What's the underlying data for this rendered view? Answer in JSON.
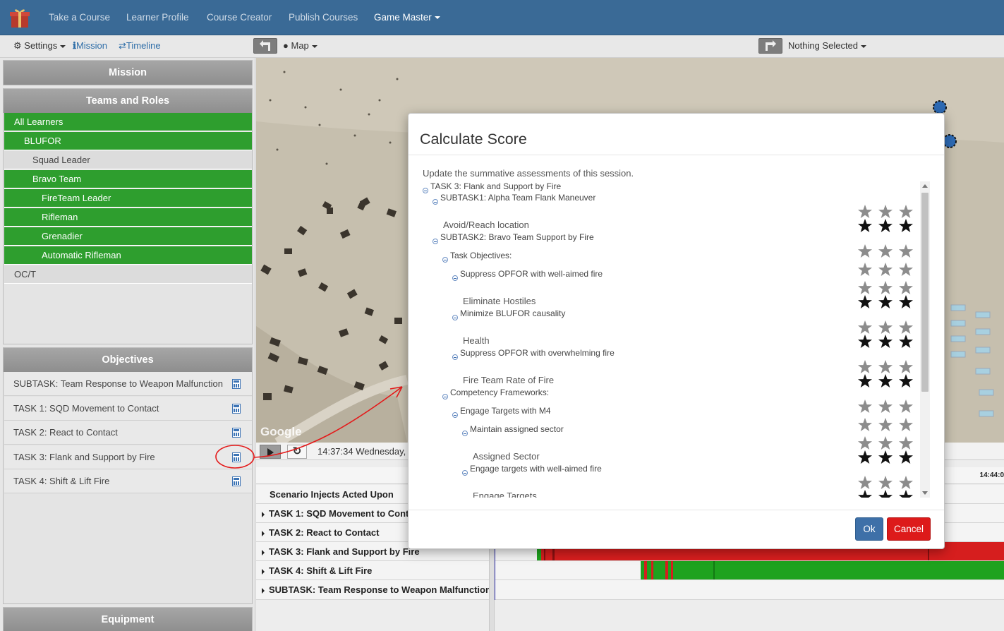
{
  "navbar": {
    "items": [
      "Take a Course",
      "Learner Profile",
      "Course Creator",
      "Publish Courses",
      "Game Master"
    ]
  },
  "toolbar": {
    "settings": "Settings",
    "mission": "Mission",
    "timeline": "Timeline",
    "map": "Map",
    "selection": "Nothing Selected"
  },
  "left": {
    "mission_header": "Mission",
    "teams_header": "Teams and Roles",
    "teams": [
      "All Learners",
      "BLUFOR",
      "Squad Leader",
      "Bravo Team",
      "FireTeam Leader",
      "Rifleman",
      "Grenadier",
      "Automatic Rifleman",
      "OC/T"
    ],
    "objectives_header": "Objectives",
    "objectives": [
      "SUBTASK: Team Response to Weapon Malfunction",
      "TASK 1: SQD Movement to Contact",
      "TASK 2: React to Contact",
      "TASK 3: Flank and Support by Fire",
      "TASK 4: Shift & Lift Fire"
    ],
    "equipment_header": "Equipment"
  },
  "map": {
    "watermark": "Google",
    "playback_time": "14:37:34 Wednesday,"
  },
  "timeline": {
    "tick": "14:44:0",
    "rows": [
      "Scenario Injects Acted Upon",
      "TASK 1: SQD Movement to Cont",
      "TASK 2: React to Contact",
      "TASK 3: Flank and Support by Fire",
      "TASK 4: Shift & Lift Fire",
      "SUBTASK: Team Response to Weapon Malfunction"
    ]
  },
  "modal": {
    "title": "Calculate Score",
    "description": "Update the summative assessments of this session.",
    "tree": [
      {
        "label": "TASK 3: Flank and Support by Fire",
        "kind": "node",
        "level": 0,
        "rating": null
      },
      {
        "label": "SUBTASK1: Alpha Team Flank Maneuver",
        "kind": "node",
        "level": 1,
        "rating": 0
      },
      {
        "label": "Avoid/Reach location",
        "kind": "leaf",
        "level": 2,
        "rating": 3
      },
      {
        "label": "SUBTASK2: Bravo Team Support by Fire",
        "kind": "node",
        "level": 1,
        "rating": 0
      },
      {
        "label": "Task Objectives:",
        "kind": "node",
        "level": 2,
        "rating": 0
      },
      {
        "label": "Suppress OPFOR with well-aimed fire",
        "kind": "node",
        "level": 3,
        "rating": 0
      },
      {
        "label": "Eliminate Hostiles",
        "kind": "leaf",
        "level": 4,
        "rating": 3
      },
      {
        "label": "Minimize BLUFOR causality",
        "kind": "node",
        "level": 3,
        "rating": 0
      },
      {
        "label": "Health",
        "kind": "leaf",
        "level": 4,
        "rating": 3
      },
      {
        "label": "Suppress OPFOR with overwhelming fire",
        "kind": "node",
        "level": 3,
        "rating": 0
      },
      {
        "label": "Fire Team Rate of Fire",
        "kind": "leaf",
        "level": 4,
        "rating": 3
      },
      {
        "label": "Competency Frameworks:",
        "kind": "node",
        "level": 2,
        "rating": 0
      },
      {
        "label": "Engage Targets with M4",
        "kind": "node",
        "level": 3,
        "rating": 0
      },
      {
        "label": "Maintain assigned sector",
        "kind": "node",
        "level": 4,
        "rating": 0
      },
      {
        "label": "Assigned Sector",
        "kind": "leaf",
        "level": 5,
        "rating": 3
      },
      {
        "label": "Engage targets with well-aimed fire",
        "kind": "node",
        "level": 4,
        "rating": 0
      },
      {
        "label": "Engage Targets",
        "kind": "leaf",
        "level": 5,
        "rating": 3
      }
    ],
    "ok_label": "Ok",
    "cancel_label": "Cancel"
  },
  "colors": {
    "navbar": "#3a6a96",
    "team_selected": "#2e9e2e",
    "bar_red": "#d61e1e",
    "bar_green": "#1ea21e",
    "ok": "#3e70a8",
    "cancel": "#dd1a1a"
  }
}
